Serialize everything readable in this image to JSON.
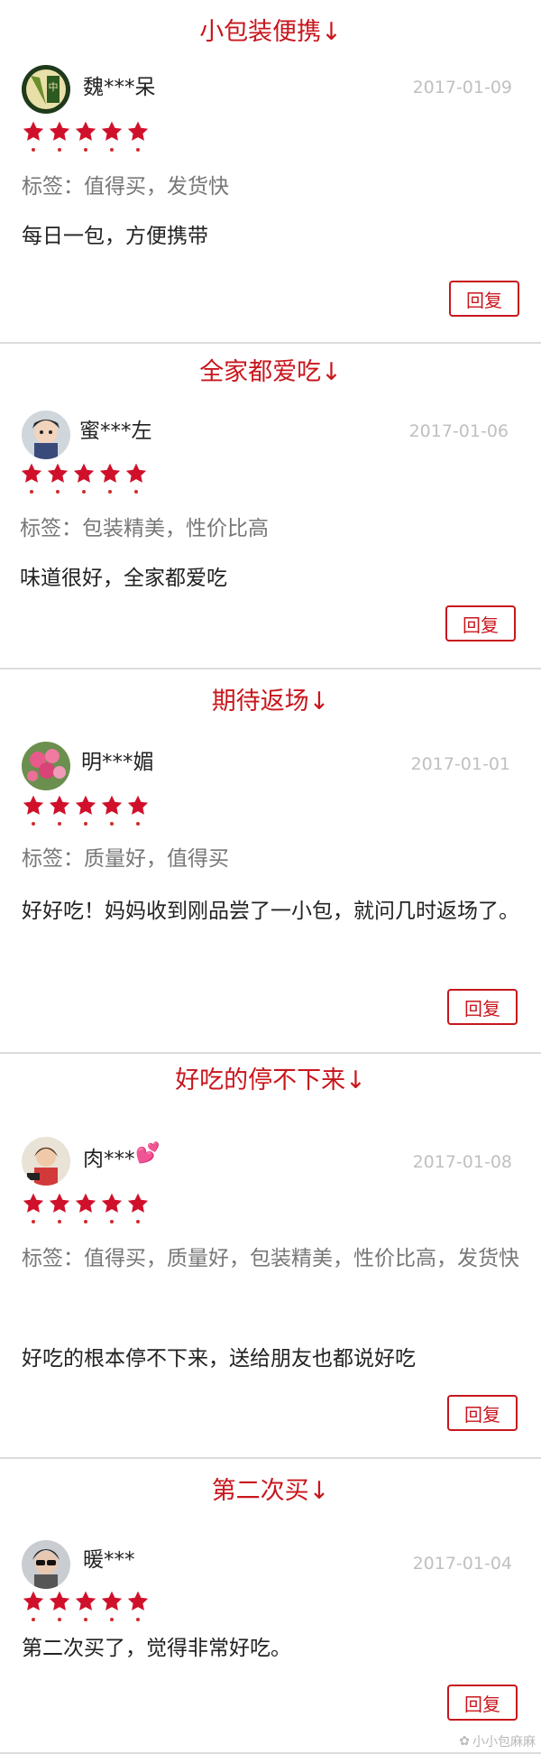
{
  "reviews": [
    {
      "title": "小包装便携↓",
      "user": "魏***呆",
      "date": "2017-01-09",
      "rating": 5,
      "tags": "标签：值得买，发货快",
      "content": "每日一包，方便携带",
      "reply": "回复",
      "avatar_icon": "avatar-badge-icon"
    },
    {
      "title": "全家都爱吃↓",
      "user": "蜜***左",
      "date": "2017-01-06",
      "rating": 5,
      "tags": "标签：包装精美，性价比高",
      "content": "味道很好，全家都爱吃",
      "reply": "回复",
      "avatar_icon": "avatar-child-icon"
    },
    {
      "title": "期待返场↓",
      "user": "明***媚",
      "date": "2017-01-01",
      "rating": 5,
      "tags": "标签：质量好，值得买",
      "content": "好好吃！妈妈收到刚品尝了一小包，就问几时返场了。",
      "reply": "回复",
      "avatar_icon": "avatar-flowers-icon"
    },
    {
      "title": "好吃的停不下来↓",
      "user": "肉***",
      "date": "2017-01-08",
      "rating": 5,
      "tags": "标签：值得买，质量好，包装精美，性价比高，发货快",
      "content": "好吃的根本停不下来，送给朋友也都说好吃",
      "reply": "回复",
      "avatar_icon": "avatar-girl-icon"
    },
    {
      "title": "第二次买↓",
      "user": "暖***",
      "date": "2017-01-04",
      "rating": 5,
      "tags": "",
      "content": "第二次买了，觉得非常好吃。",
      "reply": "回复",
      "avatar_icon": "avatar-sunglasses-icon"
    }
  ],
  "watermark": "小小包麻麻",
  "colors": {
    "accent": "#c8161d",
    "star": "#d0102a",
    "muted": "#777777",
    "date": "#c0c0c0",
    "divider": "#dcdcdc"
  }
}
